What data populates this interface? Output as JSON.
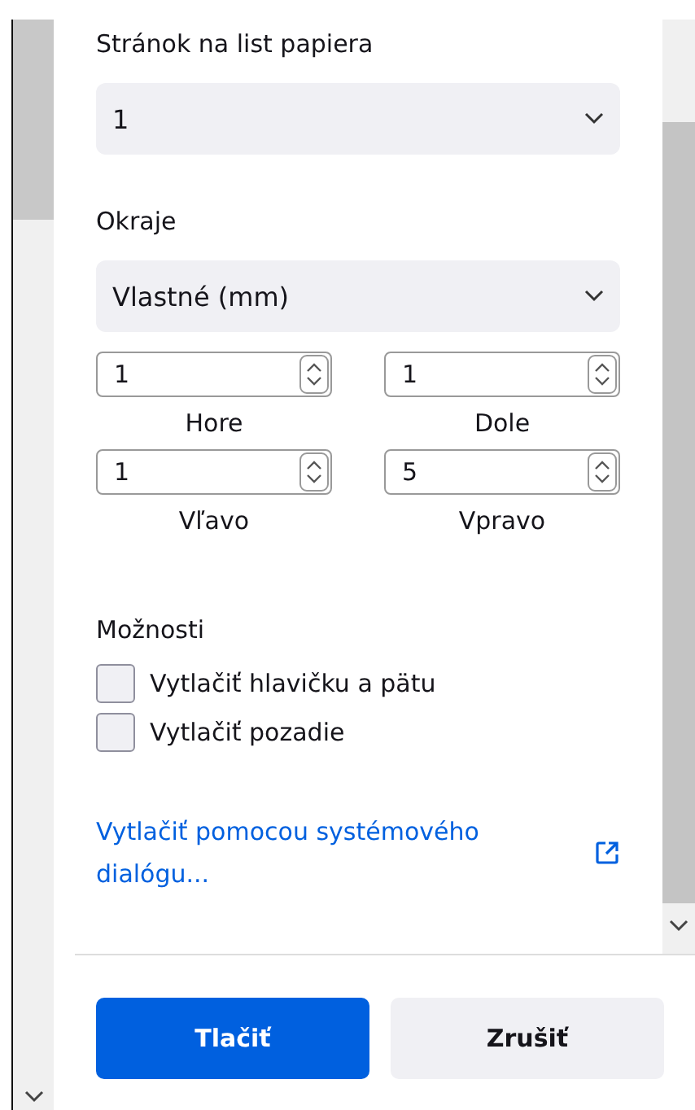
{
  "pages_per_sheet": {
    "label": "Stránok na list papiera",
    "value": "1"
  },
  "margins": {
    "label": "Okraje",
    "value": "Vlastné (mm)",
    "fields": [
      {
        "label": "Hore",
        "value": "1"
      },
      {
        "label": "Dole",
        "value": "1"
      },
      {
        "label": "Vľavo",
        "value": "1"
      },
      {
        "label": "Vpravo",
        "value": "5"
      }
    ]
  },
  "options": {
    "label": "Možnosti",
    "items": [
      {
        "label": "Vytlačiť hlavičku a pätu",
        "checked": false
      },
      {
        "label": "Vytlačiť pozadie",
        "checked": false
      }
    ]
  },
  "system_dialog_link": "Vytlačiť pomocou systémového dialógu...",
  "buttons": [
    {
      "label": "Tlačiť",
      "kind": "primary"
    },
    {
      "label": "Zrušiť",
      "kind": "secondary"
    }
  ]
}
